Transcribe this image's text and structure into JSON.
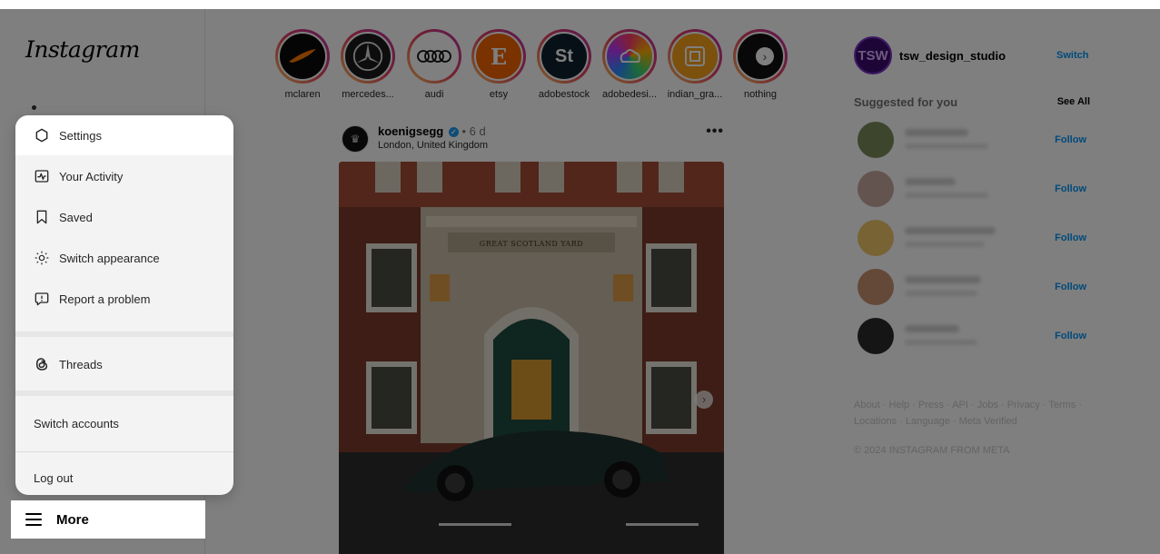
{
  "brand": {
    "logo_text": "Instagram"
  },
  "stories": [
    {
      "label": "mclaren",
      "glyph": "",
      "bg": "#0b0b0b",
      "fg": "#ff7a00"
    },
    {
      "label": "mercedes...",
      "glyph": "",
      "bg": "#1a1a1a",
      "fg": "#dcdcdc"
    },
    {
      "label": "audi",
      "glyph": "",
      "bg": "#ffffff",
      "fg": "#111111"
    },
    {
      "label": "etsy",
      "glyph": "E",
      "bg": "#f56400",
      "fg": "#ffffff"
    },
    {
      "label": "adobestock",
      "glyph": "St",
      "bg": "#11202f",
      "fg": "#ffffff"
    },
    {
      "label": "adobedesi...",
      "glyph": "",
      "bg": "#ff3a70",
      "fg": "#ffffff"
    },
    {
      "label": "indian_gra...",
      "glyph": "",
      "bg": "#f8a01b",
      "fg": "#ffffff"
    },
    {
      "label": "nothing",
      "glyph": "",
      "bg": "#101010",
      "fg": "#ffffff"
    }
  ],
  "post": {
    "username": "koenigsegg",
    "time": "• 6 d",
    "location": "London, United Kingdom",
    "more": "•••",
    "sign_text": "GREAT SCOTLAND YARD"
  },
  "profile": {
    "username": "tsw_design_studio",
    "switch_label": "Switch"
  },
  "suggestions": {
    "title": "Suggested for you",
    "see_all": "See All",
    "follow_label": "Follow",
    "count_rows": [
      {
        "avatar": "#7a8a5a"
      },
      {
        "avatar": "#c9a9a0"
      },
      {
        "avatar": "#f1c76a"
      },
      {
        "avatar": "#c89070"
      },
      {
        "avatar": "#2a2a2a"
      }
    ]
  },
  "footer": {
    "links": "About · Help · Press · API · Jobs · Privacy · Terms · Locations · Language · Meta Verified",
    "copyright": "© 2024 INSTAGRAM FROM META"
  },
  "menu": {
    "items": [
      {
        "label": "Settings",
        "icon": "gear-icon"
      },
      {
        "label": "Your Activity",
        "icon": "activity-icon"
      },
      {
        "label": "Saved",
        "icon": "bookmark-icon"
      },
      {
        "label": "Switch appearance",
        "icon": "sun-icon"
      },
      {
        "label": "Report a problem",
        "icon": "report-icon"
      }
    ],
    "threads": {
      "label": "Threads",
      "icon": "threads-icon"
    },
    "switch_accounts": "Switch accounts",
    "logout": "Log out"
  },
  "more_button": {
    "label": "More",
    "icon": "hamburger-icon"
  }
}
